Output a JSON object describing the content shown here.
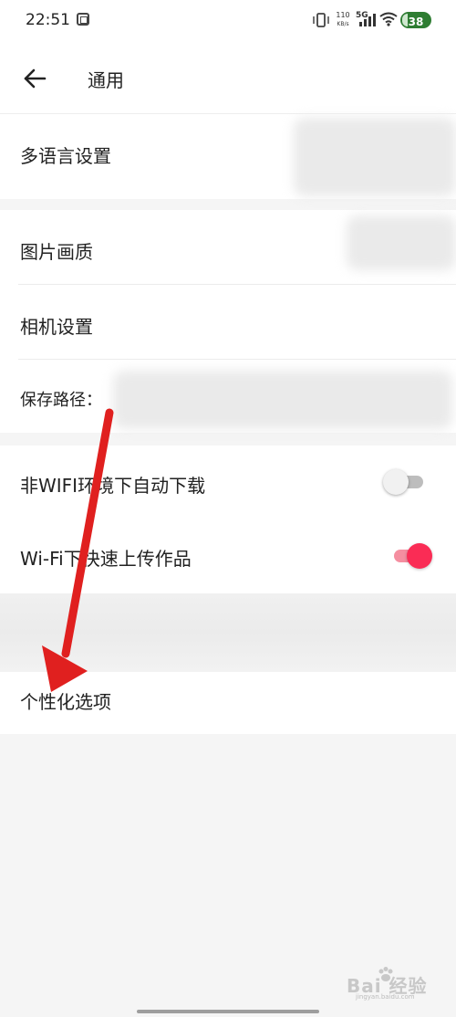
{
  "status_bar": {
    "time": "22:51",
    "speed_value": "110",
    "speed_unit": "KB/s",
    "network": "5G",
    "battery": "38",
    "icons": [
      "app-icon",
      "vibrate-icon",
      "signal-icon",
      "wifi-icon",
      "battery-icon"
    ]
  },
  "header": {
    "title": "通用",
    "back_icon": "back-arrow-icon"
  },
  "settings": {
    "multi_language": "多语言设置",
    "image_quality": "图片画质",
    "camera_settings": "相机设置",
    "save_path_label": "保存路径：",
    "auto_download_non_wifi": {
      "label": "非WIFI环境下自动下载",
      "enabled": false
    },
    "wifi_fast_upload": {
      "label": "Wi-Fi下快速上传作品",
      "enabled": true
    },
    "personalization": "个性化选项"
  },
  "colors": {
    "accent": "#fa2c55",
    "accent_track": "#f58ea0",
    "annotation_arrow": "#e0201f",
    "background": "#f5f5f5"
  },
  "watermark": {
    "text": "Bai 经验",
    "sub": "jingyan.baidu.com"
  }
}
